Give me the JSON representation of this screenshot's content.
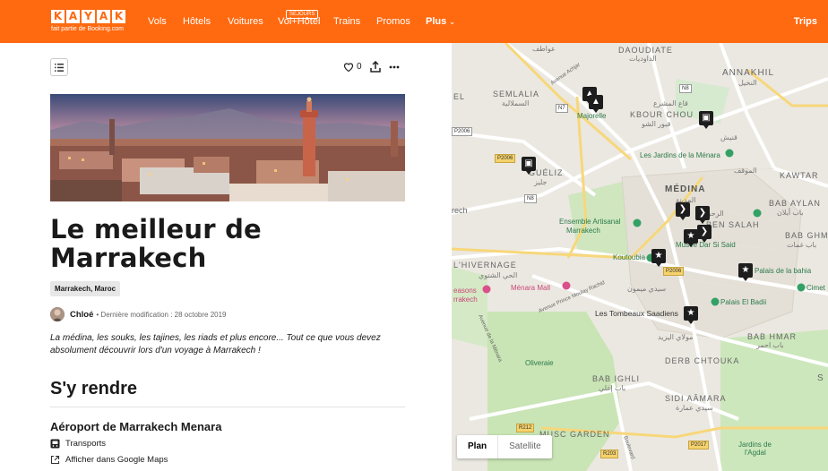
{
  "header": {
    "logo_letters": [
      "K",
      "A",
      "Y",
      "A",
      "K"
    ],
    "logo_tagline": "fait partie de Booking.com",
    "nav": [
      {
        "label": "Vols"
      },
      {
        "label": "Hôtels"
      },
      {
        "label": "Voitures"
      },
      {
        "label": "Vol+Hôtel",
        "badge": "SÉJOURS"
      },
      {
        "label": "Trains"
      },
      {
        "label": "Promos"
      },
      {
        "label": "Plus"
      }
    ],
    "trips": "Trips"
  },
  "article": {
    "like_count": "0",
    "title": "Le meilleur de Marrakech",
    "location_tag": "Marrakech, Maroc",
    "author": "Chloé",
    "meta": "• Dernière modification : 28 octobre 2019",
    "intro": "La médina, les souks, les tajines, les riads et plus encore... Tout ce que vous devez absolument découvrir lors d'un voyage à Marrakech !",
    "section_title": "S'y rendre",
    "place_title": "Aéroport de Marrakech Menara",
    "place_category": "Transports",
    "maps_link": "Afficher dans Google Maps"
  },
  "map": {
    "labels": {
      "daoudiate": "DAOUDIATE",
      "daoudiate_ar": "الداوديات",
      "annakhil": "ANNAKHIL",
      "annakhil_ar": "النخيل",
      "semlalia": "SEMLALIA",
      "semlalia_ar": "السملالية",
      "aouatif_ar": "عواطف",
      "el": "EL",
      "majorelle": "Majorelle",
      "kbour_chou": "KBOUR CHOU",
      "kbour_chou_ar": "قبور الشو",
      "quaa_ar": "قاع المشرع",
      "guéliz": "GUÉLIZ",
      "guéliz_ar": "جليز",
      "jardins_menara": "Les Jardins de la Ménara",
      "mouqaf_ar": "الموقف",
      "kawtar": "KAWTAR",
      "qannis_ar": "قنيش",
      "medina": "MÉDINA",
      "medina_ar": "المدينة",
      "bab_aylan": "BAB AYLAN",
      "bab_aylan_ar": "باب أيلان",
      "ben_salah": "BEN SALAH",
      "bab_ghma": "BAB GHMA",
      "bab_ghma_ar": "باب غمات",
      "raheba_ar": "الرحبة",
      "ensemble": "Ensemble Artisanal",
      "ensemble2": "Marrakech",
      "musee": "Musée Dar Si Said",
      "koutoubia": "Koutoubia",
      "palais_bahia": "Palais de la bahia",
      "cimet": "Cimet",
      "hivernage": "L'HIVERNAGE",
      "hivernage_ar": "الحي الشتوي",
      "menara_mall": "Ménara Mall",
      "seasons": "easons",
      "rrakech": "rrakech",
      "sidi_mimoun_ar": "سيدي ميمون",
      "palais_badii": "Palais El Badii",
      "tombeaux": "Les Tombeaux Saadiens",
      "avenue_moulay": "Avenue Prince Moulay Rachid",
      "mouassine_ar": "مولاي اليزيد",
      "oliveraie": "Oliveraie",
      "derb_chtouka": "DERB CHTOUKA",
      "bab_hmar": "BAB HMAR",
      "bab_hmar_ar": "باب احمر",
      "bab_ighli": "BAB IGHLI",
      "bab_ighli_ar": "باب إغلي",
      "sidi_aamara": "SIDI AÂMARA",
      "sidi_aamara_ar": "سيدي عمارة",
      "musc_garden": "MUSC GARDEN",
      "jardins_agdal": "Jardins de",
      "jardins_agdal2": "l'Agdal",
      "s": "S",
      "rech": "rech",
      "avenue_achjar": "Avenue Achjar",
      "avenue_menara": "Avenue de la Ménara",
      "boulevard": "Boulevard"
    },
    "road_tags": {
      "n7": "N7",
      "n8a": "N8",
      "n8b": "N8",
      "p2006a": "P2006",
      "p2006b": "P2006",
      "p2006c": "P2006",
      "r212": "R212",
      "r203": "R203",
      "p2017": "P2017"
    },
    "map_type": {
      "plan": "Plan",
      "satellite": "Satellite"
    }
  }
}
